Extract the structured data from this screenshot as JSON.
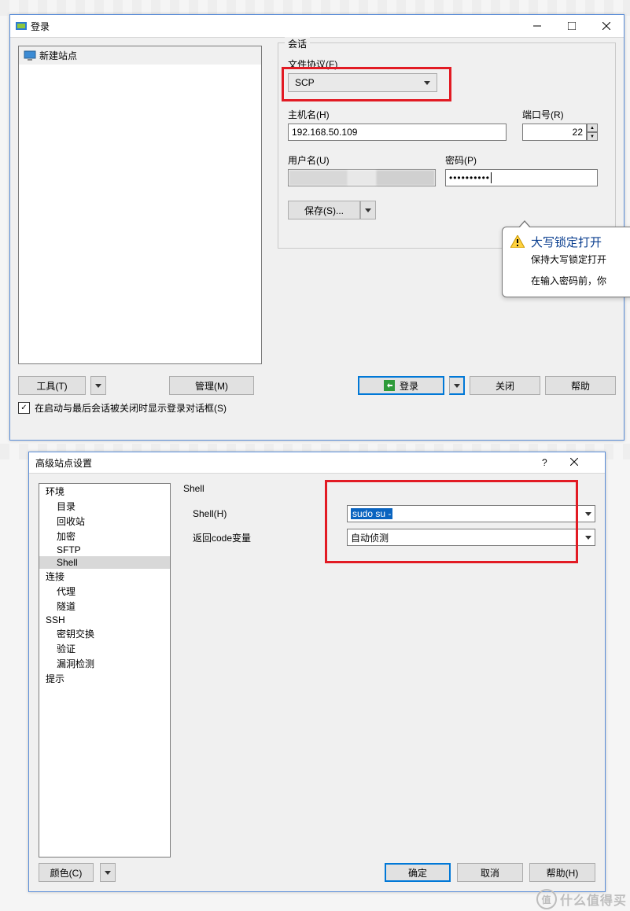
{
  "login": {
    "title": "登录",
    "site_list": {
      "new_site": "新建站点"
    },
    "session_label": "会话",
    "protocol_label": "文件协议(F)",
    "protocol_value": "SCP",
    "host_label": "主机名(H)",
    "host_value": "192.168.50.109",
    "port_label": "端口号(R)",
    "port_value": "22",
    "user_label": "用户名(U)",
    "password_label": "密码(P)",
    "password_value": "••••••••••",
    "save_button": "保存(S)...",
    "tools_button": "工具(T)",
    "manage_button": "管理(M)",
    "login_button": "登录",
    "close_button": "关闭",
    "help_button": "帮助",
    "startup_checkbox": "在启动与最后会话被关闭时显示登录对话框(S)"
  },
  "capslock": {
    "title": "大写锁定打开",
    "line1": "保持大写锁定打开",
    "line2": "在输入密码前，你"
  },
  "advanced": {
    "title": "高级站点设置",
    "tree": {
      "env": "环境",
      "dir": "目录",
      "recycle": "回收站",
      "encrypt": "加密",
      "sftp": "SFTP",
      "shell": "Shell",
      "conn": "连接",
      "proxy": "代理",
      "tunnel": "隧道",
      "ssh": "SSH",
      "kex": "密钥交换",
      "auth": "验证",
      "vuln": "漏洞检测",
      "hint": "提示"
    },
    "panel": {
      "group": "Shell",
      "shell_label": "Shell(H)",
      "shell_value": "sudo su -",
      "return_label": "返回code变量",
      "return_value": "自动侦测"
    },
    "color_button": "颜色(C)",
    "ok_button": "确定",
    "cancel_button": "取消",
    "help_button": "帮助(H)"
  },
  "watermark": "什么值得买"
}
